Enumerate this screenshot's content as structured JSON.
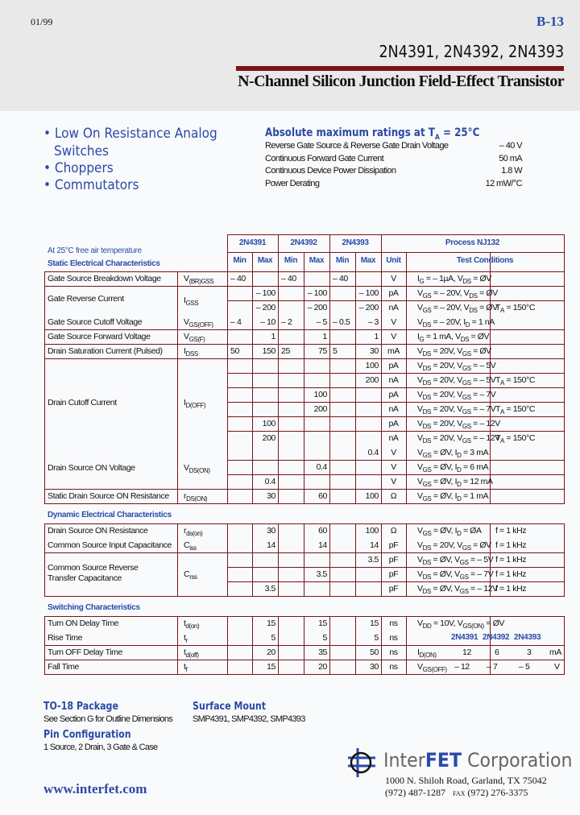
{
  "header": {
    "date": "01/99",
    "page_code": "B-13",
    "part_numbers": "2N4391, 2N4392, 2N4393",
    "subtitle": "N-Channel Silicon Junction Field-Effect Transistor"
  },
  "features": [
    "• Low On Resistance Analog",
    "Switches",
    "• Choppers",
    "• Commutators"
  ],
  "absolute_max": {
    "title": "Absolute maximum ratings at T",
    "title_sub": "A",
    "title_tail": " = 25°C",
    "rows": [
      {
        "label": "Reverse Gate Source & Reverse Gate Drain Voltage",
        "value": "– 40 V"
      },
      {
        "label": "Continuous Forward Gate Current",
        "value": "50 mA"
      },
      {
        "label": "Continuous Device Power Dissipation",
        "value": "1.8 W"
      },
      {
        "label": "Power Derating",
        "value": "12 mW/°C"
      }
    ]
  },
  "table": {
    "temp_note": "At 25°C free air temperature",
    "static_title": "Static Electrical Characteristics",
    "dynamic_title": "Dynamic Electrical Characteristics",
    "switching_title": "Switching Characteristics",
    "parts": [
      "2N4391",
      "2N4392",
      "2N4393"
    ],
    "process": "Process NJ132",
    "min": "Min",
    "max": "Max",
    "unit": "Unit",
    "test_conditions": "Test Conditions",
    "static_params": [
      {
        "name": "Gate Source Breakdown Voltage",
        "sym": "V",
        "sym_sub": "(BR)GSS"
      },
      {
        "name": "Gate Reverse Current",
        "sym": "I",
        "sym_sub": "GSS"
      },
      {
        "name": "Gate Source Cutoff Voltage",
        "sym": "V",
        "sym_sub": "GS(OFF)"
      },
      {
        "name": "Gate Source Forward Voltage",
        "sym": "V",
        "sym_sub": "GS(F)"
      },
      {
        "name": "Drain Saturation Current (Pulsed)",
        "sym": "I",
        "sym_sub": "DSS"
      },
      {
        "name": "Drain Cutoff Current",
        "sym": "I",
        "sym_sub": "D(OFF)"
      },
      {
        "name": "Drain Source ON Voltage",
        "sym": "V",
        "sym_sub": "DS(ON)"
      },
      {
        "name": "Static Drain Source ON Resistance",
        "sym": "r",
        "sym_sub": "DS(ON)"
      }
    ],
    "static_rows": [
      {
        "v": [
          "– 40",
          "",
          "– 40",
          "",
          "– 40",
          ""
        ],
        "unit": "V",
        "cond": "I_G = – 1µA, V_DS = ØV",
        "extra": ""
      },
      {
        "v": [
          "",
          "– 100",
          "",
          "– 100",
          "",
          "– 100"
        ],
        "unit": "pA",
        "cond": "V_GS = – 20V, V_DS = ØV",
        "extra": ""
      },
      {
        "v": [
          "",
          "– 200",
          "",
          "– 200",
          "",
          "– 200"
        ],
        "unit": "nA",
        "cond": "V_GS = – 20V, V_DS = ØV",
        "extra": "T_A = 150°C"
      },
      {
        "v": [
          "– 4",
          "– 10",
          "– 2",
          "– 5",
          "– 0.5",
          "– 3"
        ],
        "unit": "V",
        "cond": "V_DS = – 20V, I_D = 1 nA",
        "extra": ""
      },
      {
        "v": [
          "",
          "1",
          "",
          "1",
          "",
          "1"
        ],
        "unit": "V",
        "cond": "I_G = 1 mA, V_DS = ØV",
        "extra": ""
      },
      {
        "v": [
          "50",
          "150",
          "25",
          "75",
          "5",
          "30"
        ],
        "unit": "mA",
        "cond": "V_DS = 20V, V_GS = ØV",
        "extra": ""
      },
      {
        "v": [
          "",
          "",
          "",
          "",
          "",
          "100"
        ],
        "unit": "pA",
        "cond": "V_DS = 20V, V_GS = – 5V",
        "extra": ""
      },
      {
        "v": [
          "",
          "",
          "",
          "",
          "",
          "200"
        ],
        "unit": "nA",
        "cond": "V_DS = 20V, V_GS = – 5V",
        "extra": "T_A = 150°C"
      },
      {
        "v": [
          "",
          "",
          "",
          "100",
          "",
          ""
        ],
        "unit": "pA",
        "cond": "V_DS = 20V, V_GS = – 7V",
        "extra": ""
      },
      {
        "v": [
          "",
          "",
          "",
          "200",
          "",
          ""
        ],
        "unit": "nA",
        "cond": "V_DS = 20V, V_GS = – 7V",
        "extra": "T_A = 150°C"
      },
      {
        "v": [
          "",
          "100",
          "",
          "",
          "",
          ""
        ],
        "unit": "pA",
        "cond": "V_DS = 20V, V_GS = – 12V",
        "extra": ""
      },
      {
        "v": [
          "",
          "200",
          "",
          "",
          "",
          ""
        ],
        "unit": "nA",
        "cond": "V_DS = 20V, V_GS = – 12V",
        "extra": "T_A = 150°C"
      },
      {
        "v": [
          "",
          "",
          "",
          "",
          "",
          "0.4"
        ],
        "unit": "V",
        "cond": "V_GS = ØV, I_D = 3 mA",
        "extra": ""
      },
      {
        "v": [
          "",
          "",
          "",
          "0.4",
          "",
          ""
        ],
        "unit": "V",
        "cond": "V_GS = ØV, I_D = 6 mA",
        "extra": ""
      },
      {
        "v": [
          "",
          "0.4",
          "",
          "",
          "",
          ""
        ],
        "unit": "V",
        "cond": "V_GS = ØV, I_D = 12 mA",
        "extra": ""
      },
      {
        "v": [
          "",
          "30",
          "",
          "60",
          "",
          "100"
        ],
        "unit": "Ω",
        "cond": "V_GS = ØV, I_D = 1 mA",
        "extra": ""
      }
    ],
    "dynamic_params": [
      {
        "name": "Drain Source ON Resistance",
        "sym": "r",
        "sym_sub": "ds(on)"
      },
      {
        "name": "Common Source Input Capacitance",
        "sym": "C",
        "sym_sub": "iss"
      },
      {
        "name": "Common Source Reverse",
        "name2": "Transfer Capacitance",
        "sym": "C",
        "sym_sub": "rss"
      }
    ],
    "dynamic_rows": [
      {
        "v": [
          "",
          "30",
          "",
          "60",
          "",
          "100"
        ],
        "unit": "Ω",
        "cond": "V_GS = ØV, I_D = ØA",
        "extra": "f = 1 kHz"
      },
      {
        "v": [
          "",
          "14",
          "",
          "14",
          "",
          "14"
        ],
        "unit": "pF",
        "cond": "V_DS = 20V, V_GS = ØV",
        "extra": "f = 1 kHz"
      },
      {
        "v": [
          "",
          "",
          "",
          "",
          "",
          "3.5"
        ],
        "unit": "pF",
        "cond": "V_DS = ØV, V_GS = – 5V",
        "extra": "f = 1 kHz"
      },
      {
        "v": [
          "",
          "",
          "",
          "3.5",
          "",
          ""
        ],
        "unit": "pF",
        "cond": "V_DS = ØV, V_GS = – 7V",
        "extra": "f = 1 kHz"
      },
      {
        "v": [
          "",
          "3.5",
          "",
          "",
          "",
          ""
        ],
        "unit": "pF",
        "cond": "V_DS = ØV, V_GS = – 12V",
        "extra": "f = 1 kHz"
      }
    ],
    "switching_params": [
      {
        "name": "Turn ON Delay Time",
        "sym": "t",
        "sym_sub": "d(on)"
      },
      {
        "name": "Rise Time",
        "sym": "t",
        "sym_sub": "r"
      },
      {
        "name": "Turn OFF Delay Time",
        "sym": "t",
        "sym_sub": "d(off)"
      },
      {
        "name": "Fall Time",
        "sym": "t",
        "sym_sub": "f"
      }
    ],
    "switching_rows": [
      {
        "v": [
          "",
          "15",
          "",
          "15",
          "",
          "15"
        ],
        "unit": "ns"
      },
      {
        "v": [
          "",
          "5",
          "",
          "5",
          "",
          "5"
        ],
        "unit": "ns"
      },
      {
        "v": [
          "",
          "20",
          "",
          "35",
          "",
          "50"
        ],
        "unit": "ns"
      },
      {
        "v": [
          "",
          "15",
          "",
          "20",
          "",
          "30"
        ],
        "unit": "ns"
      }
    ],
    "switching_cond": {
      "line1": "V_DD = 10V, V_GS(ON) = ØV",
      "parts": [
        "2N4391",
        "2N4392",
        "2N4393"
      ],
      "id_on_sym": "I",
      "id_on_sub": "D(ON)",
      "id_on_vals": [
        "12",
        "6",
        "3"
      ],
      "id_on_unit": "mA",
      "vgs_off_sym": "V",
      "vgs_off_sub": "GS(OFF)",
      "vgs_off_vals": [
        "– 12",
        "– 7",
        "– 5"
      ],
      "vgs_off_unit": "V"
    }
  },
  "footer": {
    "package_title": "TO-18 Package",
    "package_text": "See Section G for Outline Dimensions",
    "pin_title": "Pin Configuration",
    "pin_text": "1 Source, 2 Drain, 3 Gate & Case",
    "smt_title": "Surface Mount",
    "smt_text": "SMP4391, SMP4392, SMP4393",
    "website": "www.interfet.com",
    "company_a": "Inter",
    "company_b": "FET",
    "company_c": " Corporation",
    "address": "1000 N. Shiloh Road, Garland, TX 75042",
    "phone": "(972) 487-1287",
    "fax_label": "FAX",
    "fax": "(972) 276-3375"
  },
  "colors": {
    "accent_blue": "#2a4aa5",
    "rule_red": "#7a1416",
    "header_bg": "#e9e9e9"
  }
}
